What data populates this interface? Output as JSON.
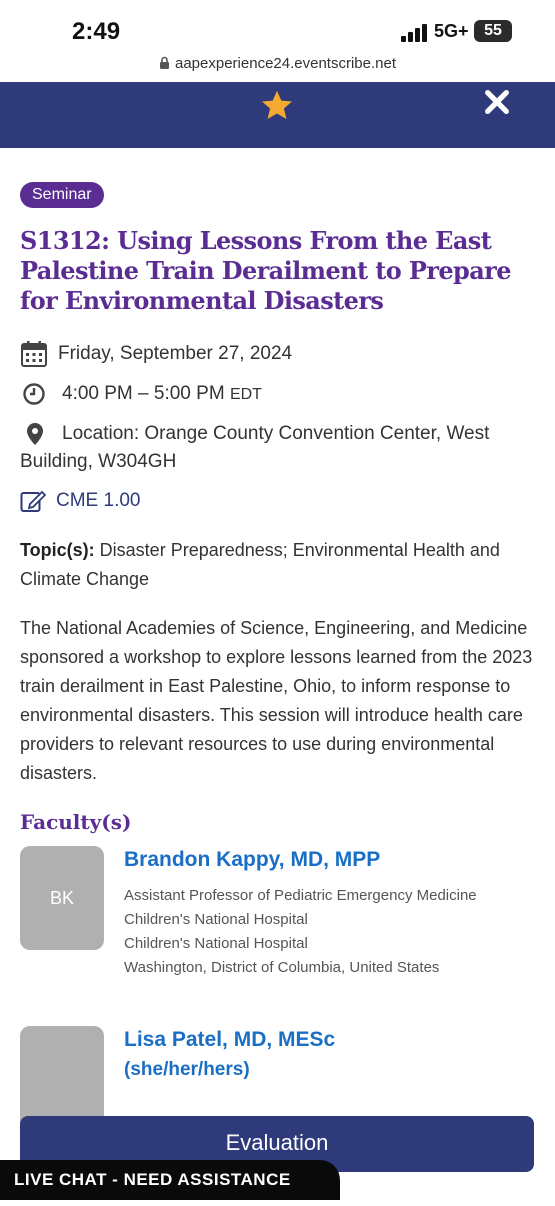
{
  "status_bar": {
    "time": "2:49",
    "network": "5G+",
    "battery": "55"
  },
  "browser": {
    "url": "aapexperience24.eventscribe.net"
  },
  "nav": {
    "star_icon": "star-icon",
    "close_icon": "close-icon",
    "bg_color": "#2f3a7a",
    "star_color": "#f4a930"
  },
  "session": {
    "badge": "Seminar",
    "title": "S1312: Using Lessons From the East Palestine Train Derailment to Prepare for Environmental Disasters",
    "date": "Friday, September 27, 2024",
    "time": "4:00 PM – 5:00 PM",
    "timezone": "EDT",
    "location": "Location: Orange County Convention Center, West Building, W304GH",
    "cme": "CME 1.00",
    "topics_label": "Topic(s):",
    "topics": "Disaster Preparedness; Environmental Health and Climate Change",
    "description": "The National Academies of Science, Engineering, and Medicine sponsored a workshop to explore lessons learned from the 2023 train derailment in East Palestine, Ohio, to inform response to environmental disasters. This session will introduce health care providers to relevant resources to use during environmental disasters."
  },
  "faculty": {
    "heading": "Faculty(s)",
    "people": [
      {
        "initials": "BK",
        "name": "Brandon Kappy, MD, MPP",
        "role": "Assistant Professor of Pediatric Emergency Medicine",
        "org1": "Children's National Hospital",
        "org2": "Children's National Hospital",
        "location": "Washington, District of Columbia, United States"
      },
      {
        "initials": "",
        "name": "Lisa Patel, MD, MESc",
        "pronouns": "(she/her/hers)"
      }
    ]
  },
  "actions": {
    "evaluation": "Evaluation",
    "live_chat": "LIVE CHAT - NEED ASSISTANCE"
  },
  "colors": {
    "purple": "#5b2d93",
    "navy": "#2f3a7a",
    "link_blue": "#1a6fc4"
  }
}
